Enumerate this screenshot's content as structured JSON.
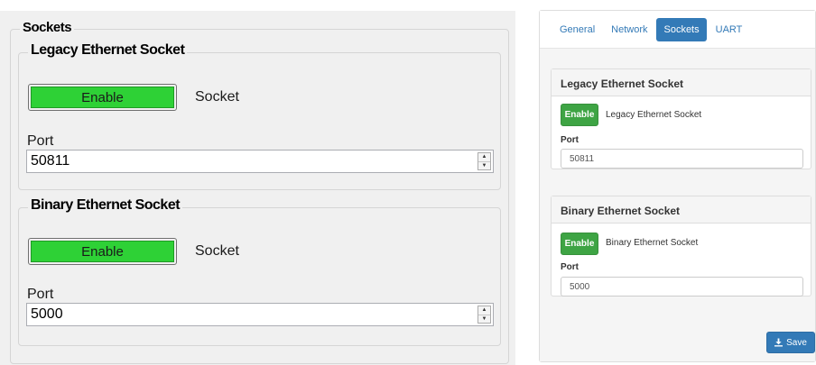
{
  "desktop": {
    "group_title": "Sockets",
    "legacy": {
      "title": "Legacy Ethernet Socket",
      "enable_label": "Enable",
      "socket_label": "Socket",
      "port_label": "Port",
      "port_value": "50811"
    },
    "binary": {
      "title": "Binary Ethernet Socket",
      "enable_label": "Enable",
      "socket_label": "Socket",
      "port_label": "Port",
      "port_value": "5000"
    }
  },
  "web": {
    "tabs": [
      {
        "label": "General",
        "active": false
      },
      {
        "label": "Network",
        "active": false
      },
      {
        "label": "Sockets",
        "active": true
      },
      {
        "label": "UART",
        "active": false
      }
    ],
    "legacy": {
      "title": "Legacy Ethernet Socket",
      "enable_label": "Enable",
      "enable_desc": "Legacy Ethernet Socket",
      "port_label": "Port",
      "port_value": "50811"
    },
    "binary": {
      "title": "Binary Ethernet Socket",
      "enable_label": "Enable",
      "enable_desc": "Binary Ethernet Socket",
      "port_label": "Port",
      "port_value": "5000"
    },
    "save_label": "Save",
    "save_icon": "download-icon"
  },
  "colors": {
    "win_enable_green": "#2ed136",
    "web_enable_green": "#3ea444",
    "web_primary": "#337ab7"
  }
}
